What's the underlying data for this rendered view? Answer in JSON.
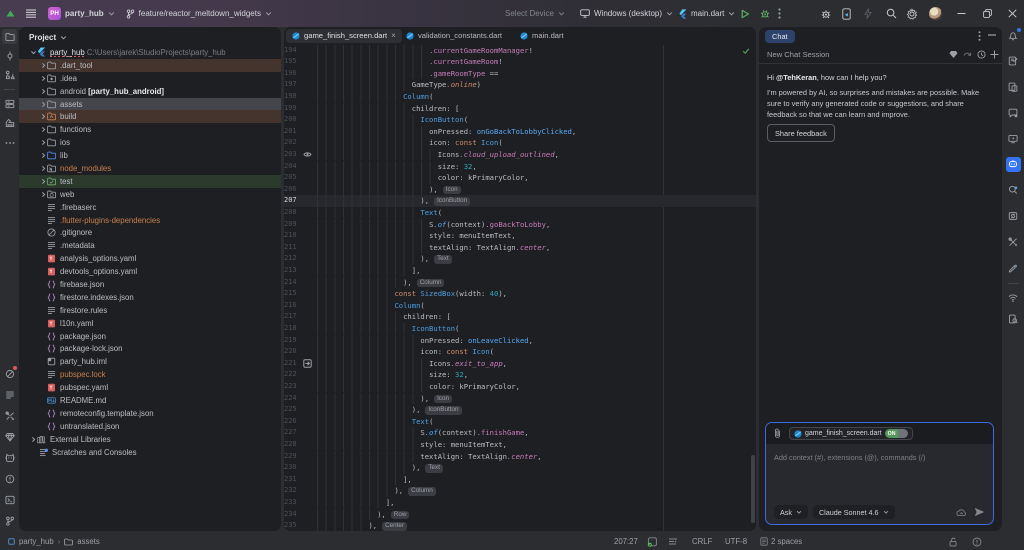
{
  "titlebar": {
    "project_badge": "PH",
    "project_name": "party_hub",
    "branch_name": "feature/reactor_meltdown_widgets",
    "device_selector": "Select Device",
    "target_device": "Windows (desktop)",
    "run_config": "main.dart"
  },
  "left_strip": {
    "top": [
      {
        "name": "project-folder-icon",
        "active": true
      },
      {
        "name": "commit-icon"
      },
      {
        "name": "structure-icon"
      },
      {
        "name": "divider"
      },
      {
        "name": "services-icon"
      },
      {
        "name": "build-variants-icon"
      },
      {
        "name": "more-icon"
      }
    ],
    "bottom": [
      {
        "name": "app-quality-insights-icon",
        "badge": "#e05555"
      },
      {
        "name": "todo-icon"
      },
      {
        "name": "build-tools-icon"
      },
      {
        "name": "dart-analysis-icon"
      },
      {
        "name": "logcat-icon"
      },
      {
        "name": "problems-icon"
      },
      {
        "name": "terminal-icon"
      },
      {
        "name": "git-icon"
      }
    ]
  },
  "right_strip": {
    "top": [
      {
        "name": "notifications-icon",
        "badge": "#3574f0"
      },
      {
        "name": "gradle-icon"
      },
      {
        "name": "device-manager-icon"
      },
      {
        "name": "gemini-chat-icon"
      },
      {
        "name": "running-devices-icon"
      },
      {
        "name": "ai-assistant-icon",
        "activeBlue": true
      },
      {
        "name": "ai-search-icon"
      },
      {
        "name": "sync-icon"
      },
      {
        "name": "tools-icon"
      },
      {
        "name": "pen-icon"
      },
      {
        "name": "divider"
      },
      {
        "name": "wifi-icon",
        "smallGap": true
      },
      {
        "name": "device-explorer-icon",
        "smallGap": true
      }
    ]
  },
  "project_panel": {
    "header": "Project",
    "tree": [
      {
        "label": "party_hub",
        "path": " C:\\Users\\jarek\\StudioProjects\\party_hub",
        "icon": "flutter",
        "level": 0,
        "arrow": "open",
        "error": true
      },
      {
        "label": ".dart_tool",
        "icon": "folder",
        "level": 1,
        "arrow": "closed",
        "row": "excluded"
      },
      {
        "label": ".idea",
        "icon": "folder-idea",
        "level": 1,
        "arrow": "closed"
      },
      {
        "label": "android",
        "suffix": " [party_hub_android]",
        "icon": "folder",
        "level": 1,
        "arrow": "closed"
      },
      {
        "label": "assets",
        "icon": "folder",
        "level": 1,
        "arrow": "closed",
        "row": "selected"
      },
      {
        "label": "build",
        "icon": "folder-build",
        "level": 1,
        "arrow": "closed",
        "row": "excluded"
      },
      {
        "label": "functions",
        "icon": "folder",
        "level": 1,
        "arrow": "closed"
      },
      {
        "label": "ios",
        "icon": "folder",
        "level": 1,
        "arrow": "closed"
      },
      {
        "label": "lib",
        "icon": "folder-lib",
        "level": 1,
        "arrow": "closed"
      },
      {
        "label": "node_modules",
        "icon": "folder-node",
        "level": 1,
        "arrow": "closed",
        "text": "ignored"
      },
      {
        "label": "test",
        "icon": "folder-test",
        "level": 1,
        "arrow": "closed",
        "row": "test"
      },
      {
        "label": "web",
        "icon": "folder-web",
        "level": 1,
        "arrow": "closed"
      },
      {
        "label": ".firebaserc",
        "icon": "text",
        "level": 1
      },
      {
        "label": ".flutter-plugins-dependencies",
        "icon": "text",
        "level": 1,
        "text": "ignored"
      },
      {
        "label": ".gitignore",
        "icon": "ignore",
        "level": 1
      },
      {
        "label": ".metadata",
        "icon": "text",
        "level": 1
      },
      {
        "label": "analysis_options.yaml",
        "icon": "yaml",
        "level": 1
      },
      {
        "label": "devtools_options.yaml",
        "icon": "yaml",
        "level": 1
      },
      {
        "label": "firebase.json",
        "icon": "json",
        "level": 1
      },
      {
        "label": "firestore.indexes.json",
        "icon": "json",
        "level": 1
      },
      {
        "label": "firestore.rules",
        "icon": "text",
        "level": 1
      },
      {
        "label": "l10n.yaml",
        "icon": "yaml",
        "level": 1
      },
      {
        "label": "package.json",
        "icon": "json",
        "level": 1
      },
      {
        "label": "package-lock.json",
        "icon": "json",
        "level": 1
      },
      {
        "label": "party_hub.iml",
        "icon": "iml",
        "level": 1
      },
      {
        "label": "pubspec.lock",
        "icon": "text",
        "level": 1,
        "text": "ignored"
      },
      {
        "label": "pubspec.yaml",
        "icon": "yaml",
        "level": 1
      },
      {
        "label": "README.md",
        "icon": "md",
        "level": 1
      },
      {
        "label": "remoteconfig.template.json",
        "icon": "json",
        "level": 1
      },
      {
        "label": "untranslated.json",
        "icon": "json",
        "level": 1
      },
      {
        "label": "External Libraries",
        "icon": "libraries",
        "level": 0,
        "arrow": "closed"
      },
      {
        "label": "Scratches and Consoles",
        "icon": "scratches",
        "level": 0
      }
    ]
  },
  "editor": {
    "tabs": [
      {
        "label": "game_finish_screen.dart",
        "active": true,
        "closable": true
      },
      {
        "label": "validation_constants.dart"
      },
      {
        "label": "main.dart"
      }
    ],
    "current_line": 207,
    "first_line": 194,
    "code": [
      {
        "n": 194,
        "col": 26,
        "seg": [
          [
            "pu",
            ".currentGameRoomManager"
          ],
          [
            "df",
            "!"
          ]
        ]
      },
      {
        "n": 195,
        "col": 26,
        "seg": [
          [
            "pu",
            ".currentGameRoom"
          ],
          [
            "df",
            "!"
          ]
        ]
      },
      {
        "n": 196,
        "col": 26,
        "seg": [
          [
            "pu",
            ".gameRoomType"
          ],
          [
            "df",
            " =="
          ]
        ]
      },
      {
        "n": 197,
        "col": 22,
        "seg": [
          [
            "df",
            "GameType"
          ],
          [
            "oi",
            ".online"
          ],
          [
            "df",
            ")"
          ]
        ]
      },
      {
        "n": 198,
        "col": 20,
        "seg": [
          [
            "cl",
            "Column"
          ],
          [
            "df",
            "("
          ]
        ]
      },
      {
        "n": 199,
        "col": 22,
        "seg": [
          [
            "df",
            "children: ["
          ]
        ]
      },
      {
        "n": 200,
        "col": 24,
        "seg": [
          [
            "cl",
            "IconButton"
          ],
          [
            "df",
            "("
          ]
        ]
      },
      {
        "n": 201,
        "col": 26,
        "seg": [
          [
            "df",
            "onPressed: "
          ],
          [
            "fn",
            "onGoBackToLobbyClicked"
          ],
          [
            "df",
            ","
          ]
        ]
      },
      {
        "n": 202,
        "col": 26,
        "seg": [
          [
            "df",
            "icon: "
          ],
          [
            "kw",
            "const"
          ],
          [
            "df",
            " "
          ],
          [
            "cl",
            "Icon"
          ],
          [
            "df",
            "("
          ]
        ]
      },
      {
        "n": 203,
        "col": 28,
        "seg": [
          [
            "df",
            "Icons"
          ],
          [
            "pi",
            ".cloud_upload_outlined"
          ],
          [
            "df",
            ","
          ]
        ],
        "gutter": "eye-icon"
      },
      {
        "n": 204,
        "col": 28,
        "seg": [
          [
            "df",
            "size: "
          ],
          [
            "nm",
            "32"
          ],
          [
            "df",
            ","
          ]
        ]
      },
      {
        "n": 205,
        "col": 28,
        "seg": [
          [
            "df",
            "color: kPrimaryColor,"
          ]
        ]
      },
      {
        "n": 206,
        "col": 26,
        "seg": [
          [
            "df",
            "),"
          ]
        ],
        "inlay": "Icon"
      },
      {
        "n": 207,
        "col": 24,
        "seg": [
          [
            "df",
            "),"
          ]
        ],
        "inlay": "IconButton",
        "current": true
      },
      {
        "n": 208,
        "col": 24,
        "seg": [
          [
            "cl",
            "Text"
          ],
          [
            "df",
            "("
          ]
        ]
      },
      {
        "n": 209,
        "col": 26,
        "seg": [
          [
            "df",
            "S"
          ],
          [
            "fi",
            ".of"
          ],
          [
            "df",
            "(context)"
          ],
          [
            "pu",
            ".goBackToLobby"
          ],
          [
            "df",
            ","
          ]
        ]
      },
      {
        "n": 210,
        "col": 26,
        "seg": [
          [
            "df",
            "style: menuItemText,"
          ]
        ]
      },
      {
        "n": 211,
        "col": 26,
        "seg": [
          [
            "df",
            "textAlign: TextAlign"
          ],
          [
            "pi",
            ".center"
          ],
          [
            "df",
            ","
          ]
        ]
      },
      {
        "n": 212,
        "col": 24,
        "seg": [
          [
            "df",
            "),"
          ]
        ],
        "inlay": "Text"
      },
      {
        "n": 213,
        "col": 22,
        "seg": [
          [
            "df",
            "],"
          ]
        ]
      },
      {
        "n": 214,
        "col": 20,
        "seg": [
          [
            "df",
            "),"
          ]
        ],
        "inlay": "Column"
      },
      {
        "n": 215,
        "col": 18,
        "seg": [
          [
            "kw",
            "const"
          ],
          [
            "df",
            " "
          ],
          [
            "cl",
            "SizedBox"
          ],
          [
            "df",
            "(width: "
          ],
          [
            "nm",
            "40"
          ],
          [
            "df",
            "),"
          ]
        ]
      },
      {
        "n": 216,
        "col": 18,
        "seg": [
          [
            "cl",
            "Column"
          ],
          [
            "df",
            "("
          ]
        ]
      },
      {
        "n": 217,
        "col": 20,
        "seg": [
          [
            "df",
            "children: ["
          ]
        ]
      },
      {
        "n": 218,
        "col": 22,
        "seg": [
          [
            "cl",
            "IconButton"
          ],
          [
            "df",
            "("
          ]
        ]
      },
      {
        "n": 219,
        "col": 24,
        "seg": [
          [
            "df",
            "onPressed: "
          ],
          [
            "fn",
            "onLeaveClicked"
          ],
          [
            "df",
            ","
          ]
        ]
      },
      {
        "n": 220,
        "col": 24,
        "seg": [
          [
            "df",
            "icon: "
          ],
          [
            "kw",
            "const"
          ],
          [
            "df",
            " "
          ],
          [
            "cl",
            "Icon"
          ],
          [
            "df",
            "("
          ]
        ]
      },
      {
        "n": 221,
        "col": 26,
        "seg": [
          [
            "df",
            "Icons"
          ],
          [
            "pi",
            ".exit_to_app"
          ],
          [
            "df",
            ","
          ]
        ],
        "gutter": "jump-icon"
      },
      {
        "n": 222,
        "col": 26,
        "seg": [
          [
            "df",
            "size: "
          ],
          [
            "nm",
            "32"
          ],
          [
            "df",
            ","
          ]
        ]
      },
      {
        "n": 223,
        "col": 26,
        "seg": [
          [
            "df",
            "color: kPrimaryColor,"
          ]
        ]
      },
      {
        "n": 224,
        "col": 24,
        "seg": [
          [
            "df",
            "),"
          ]
        ],
        "inlay": "Icon"
      },
      {
        "n": 225,
        "col": 22,
        "seg": [
          [
            "df",
            "),"
          ]
        ],
        "inlay": "IconButton"
      },
      {
        "n": 226,
        "col": 22,
        "seg": [
          [
            "cl",
            "Text"
          ],
          [
            "df",
            "("
          ]
        ]
      },
      {
        "n": 227,
        "col": 24,
        "seg": [
          [
            "df",
            "S"
          ],
          [
            "fi",
            ".of"
          ],
          [
            "df",
            "(context)"
          ],
          [
            "pu",
            ".finishGame"
          ],
          [
            "df",
            ","
          ]
        ]
      },
      {
        "n": 228,
        "col": 24,
        "seg": [
          [
            "df",
            "style: menuItemText,"
          ]
        ]
      },
      {
        "n": 229,
        "col": 24,
        "seg": [
          [
            "df",
            "textAlign: TextAlign"
          ],
          [
            "pi",
            ".center"
          ],
          [
            "df",
            ","
          ]
        ]
      },
      {
        "n": 230,
        "col": 22,
        "seg": [
          [
            "df",
            "),"
          ]
        ],
        "inlay": "Text"
      },
      {
        "n": 231,
        "col": 20,
        "seg": [
          [
            "df",
            "],"
          ]
        ]
      },
      {
        "n": 232,
        "col": 18,
        "seg": [
          [
            "df",
            "),"
          ]
        ],
        "inlay": "Column"
      },
      {
        "n": 233,
        "col": 16,
        "seg": [
          [
            "df",
            "],"
          ]
        ]
      },
      {
        "n": 234,
        "col": 14,
        "seg": [
          [
            "df",
            "),"
          ]
        ],
        "inlay": "Row"
      },
      {
        "n": 235,
        "col": 12,
        "seg": [
          [
            "df",
            "),"
          ]
        ],
        "inlay": "Center"
      }
    ]
  },
  "chat": {
    "tab": "Chat",
    "session_title": "New Chat Session",
    "greeting_prefix": "Hi ",
    "mention": "@TehKeran",
    "greeting_suffix": ", how can I help you?",
    "disclaimer": "I'm powered by AI, so surprises and mistakes are possible. Make sure to verify any generated code or suggestions, and share feedback so that we can learn and improve.",
    "feedback_button": "Share feedback",
    "input": {
      "context_chip": "game_finish_screen.dart",
      "toggle_state": "ON",
      "placeholder": "Add context (#), extensions (@), commands (/)",
      "mode": "Ask",
      "model": "Claude Sonnet 4.6"
    }
  },
  "status_bar": {
    "breadcrumb_project": "party_hub",
    "breadcrumb_folder": "assets",
    "caret_position": "207:27",
    "line_separator": "CRLF",
    "encoding": "UTF-8",
    "indent": "2 spaces"
  },
  "colors": {
    "accent_blue": "#3574f0",
    "run_green": "#57965c",
    "canvas": "#2b2d30",
    "island": "#1e1f22"
  }
}
